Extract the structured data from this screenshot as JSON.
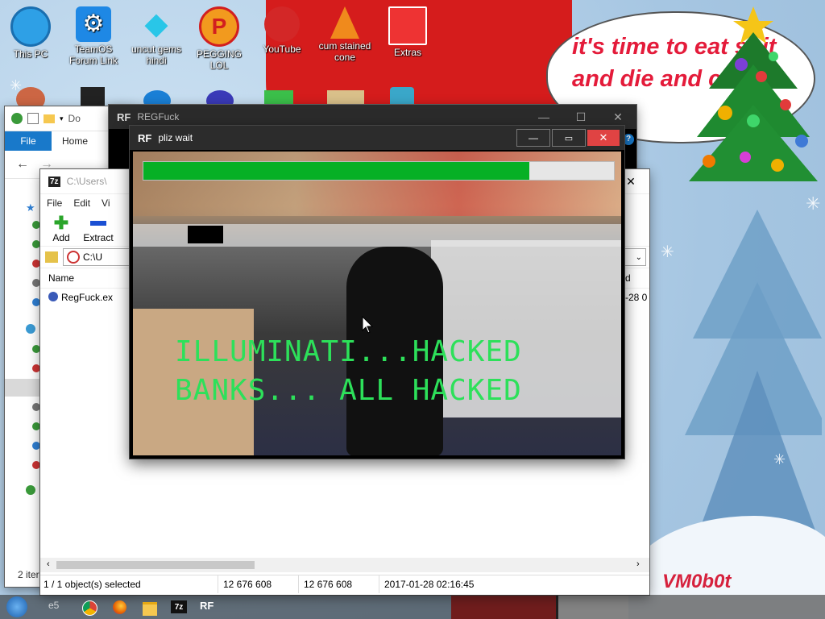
{
  "desktop": {
    "icons": [
      {
        "label": "This PC",
        "icon": "computer-icon"
      },
      {
        "label": "TeamOS Forum Link",
        "icon": "gear-icon"
      },
      {
        "label": "uncut gems hindi",
        "icon": "diamond-icon"
      },
      {
        "label": "PEGGING LOL",
        "icon": "p-logo-icon"
      },
      {
        "label": "YouTube",
        "icon": "angry-bird-icon"
      },
      {
        "label": "cum stained cone",
        "icon": "cone-icon"
      },
      {
        "label": "Extras",
        "icon": "gift-icon"
      }
    ],
    "speech_bubble": "it's time to eat shit and die and candy cane",
    "signature": "VM0b0t"
  },
  "explorer": {
    "breadcrumb_fragment": "Do",
    "ribbon_tabs": [
      "File",
      "Home"
    ]
  },
  "regfuck_window": {
    "title": "REGFuck",
    "icon": "RF"
  },
  "sevenzip": {
    "title_fragment": "C:\\Users\\",
    "menu": [
      "File",
      "Edit",
      "Vi"
    ],
    "toolbar": [
      {
        "label": "Add",
        "icon": "plus-icon"
      },
      {
        "label": "Extract",
        "icon": "minus-icon"
      }
    ],
    "path_fragment": "C:\\U",
    "column_name": "Name",
    "column_right": "d",
    "file_row": {
      "name": "RegFuck.ex",
      "date_fragment": "-28 0"
    },
    "status": {
      "selected": "1 / 1 object(s) selected",
      "size": "12 676 608",
      "packed": "12 676 608",
      "modified": "2017-01-28 02:16:45"
    },
    "left_status_fragment": "2 iter"
  },
  "wait_window": {
    "title": "pliz wait",
    "icon": "RF",
    "progress": 0.82,
    "overlay_line1": "ILLUMINATI...HACKED",
    "overlay_line2": "BANKS... ALL HACKED",
    "overlay_color": "#2de05a"
  },
  "taskbar": {
    "start_fragment": "e5",
    "apps": [
      "chrome-icon",
      "firefox-icon",
      "file-explorer-icon",
      "7zip-icon",
      "regfuck-icon"
    ],
    "sevenzip_label": "7z",
    "regfuck_label": "RF"
  },
  "colors": {
    "progress_fill": "#06b025",
    "close_red": "#e04343",
    "ribbon_blue": "#1979ca"
  }
}
